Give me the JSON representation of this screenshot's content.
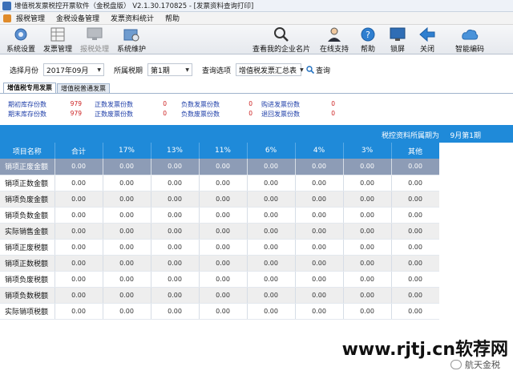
{
  "window": {
    "title": "增值税发票税控开票软件（金税盘版） V2.1.30.170825 - [发票资料查询打印]"
  },
  "menubar": {
    "items": [
      "报税管理",
      "金税设备管理",
      "发票资料统计",
      "帮助"
    ]
  },
  "toolbar": {
    "buttons": [
      {
        "label": "系统设置",
        "icon": "gear-icon",
        "enabled": true
      },
      {
        "label": "发票管理",
        "icon": "invoice-icon",
        "enabled": true
      },
      {
        "label": "报税处理",
        "icon": "monitor-icon",
        "enabled": false
      },
      {
        "label": "系统维护",
        "icon": "folder-gear-icon",
        "enabled": true
      },
      {
        "label": "查看我的企业名片",
        "icon": "magnifier-icon",
        "enabled": true
      },
      {
        "label": "在线支持",
        "icon": "support-person-icon",
        "enabled": true
      },
      {
        "label": "帮助",
        "icon": "help-icon",
        "enabled": true
      },
      {
        "label": "锁屏",
        "icon": "lock-screen-icon",
        "enabled": true
      },
      {
        "label": "关闭",
        "icon": "back-arrow-icon",
        "enabled": true
      },
      {
        "label": "智能编码",
        "icon": "cloud-icon",
        "enabled": true
      }
    ]
  },
  "query": {
    "month_label": "选择月份",
    "month_value": "2017年09月",
    "period_label": "所属税期",
    "period_value": "第1期",
    "option_label": "查询选项",
    "option_value": "增值税发票汇总表",
    "query_button": "查询"
  },
  "tabs": [
    "增值税专用发票",
    "增值税普通发票"
  ],
  "summary": {
    "items": [
      {
        "label": "期初库存份数",
        "value": "979"
      },
      {
        "label": "正数发票份数",
        "value": "0"
      },
      {
        "label": "负数发票份数",
        "value": "0"
      },
      {
        "label": "购进发票份数",
        "value": "0"
      },
      {
        "label": "期末库存份数",
        "value": "979"
      },
      {
        "label": "正数废票份数",
        "value": "0"
      },
      {
        "label": "负数废票份数",
        "value": "0"
      },
      {
        "label": "退回发票份数",
        "value": "0"
      }
    ]
  },
  "period_bar": {
    "label": "税控资料所属期为",
    "value": "9月第1期"
  },
  "grid": {
    "columns": [
      "项目名称",
      "合计",
      "17%",
      "13%",
      "11%",
      "6%",
      "4%",
      "3%",
      "其他"
    ],
    "rows": [
      {
        "name": "销项正废金额",
        "values": [
          "0.00",
          "0.00",
          "0.00",
          "0.00",
          "0.00",
          "0.00",
          "0.00",
          "0.00"
        ]
      },
      {
        "name": "销项正数金额",
        "values": [
          "0.00",
          "0.00",
          "0.00",
          "0.00",
          "0.00",
          "0.00",
          "0.00",
          "0.00"
        ]
      },
      {
        "name": "销项负废金额",
        "values": [
          "0.00",
          "0.00",
          "0.00",
          "0.00",
          "0.00",
          "0.00",
          "0.00",
          "0.00"
        ]
      },
      {
        "name": "销项负数金额",
        "values": [
          "0.00",
          "0.00",
          "0.00",
          "0.00",
          "0.00",
          "0.00",
          "0.00",
          "0.00"
        ]
      },
      {
        "name": "实际销售金额",
        "values": [
          "0.00",
          "0.00",
          "0.00",
          "0.00",
          "0.00",
          "0.00",
          "0.00",
          "0.00"
        ]
      },
      {
        "name": "销项正废税额",
        "values": [
          "0.00",
          "0.00",
          "0.00",
          "0.00",
          "0.00",
          "0.00",
          "0.00",
          "0.00"
        ]
      },
      {
        "name": "销项正数税额",
        "values": [
          "0.00",
          "0.00",
          "0.00",
          "0.00",
          "0.00",
          "0.00",
          "0.00",
          "0.00"
        ]
      },
      {
        "name": "销项负废税额",
        "values": [
          "0.00",
          "0.00",
          "0.00",
          "0.00",
          "0.00",
          "0.00",
          "0.00",
          "0.00"
        ]
      },
      {
        "name": "销项负数税额",
        "values": [
          "0.00",
          "0.00",
          "0.00",
          "0.00",
          "0.00",
          "0.00",
          "0.00",
          "0.00"
        ]
      },
      {
        "name": "实际销项税额",
        "values": [
          "0.00",
          "0.00",
          "0.00",
          "0.00",
          "0.00",
          "0.00",
          "0.00",
          "0.00"
        ]
      }
    ]
  },
  "overlay": {
    "watermark": "www.rjtj.cn软荐网",
    "wechat": "航天金税"
  },
  "colors": {
    "accent_blue": "#1f8ad9",
    "summary_label": "#1f3fa8",
    "summary_value": "#cc2020",
    "selected_row": "#8d9cb6"
  }
}
